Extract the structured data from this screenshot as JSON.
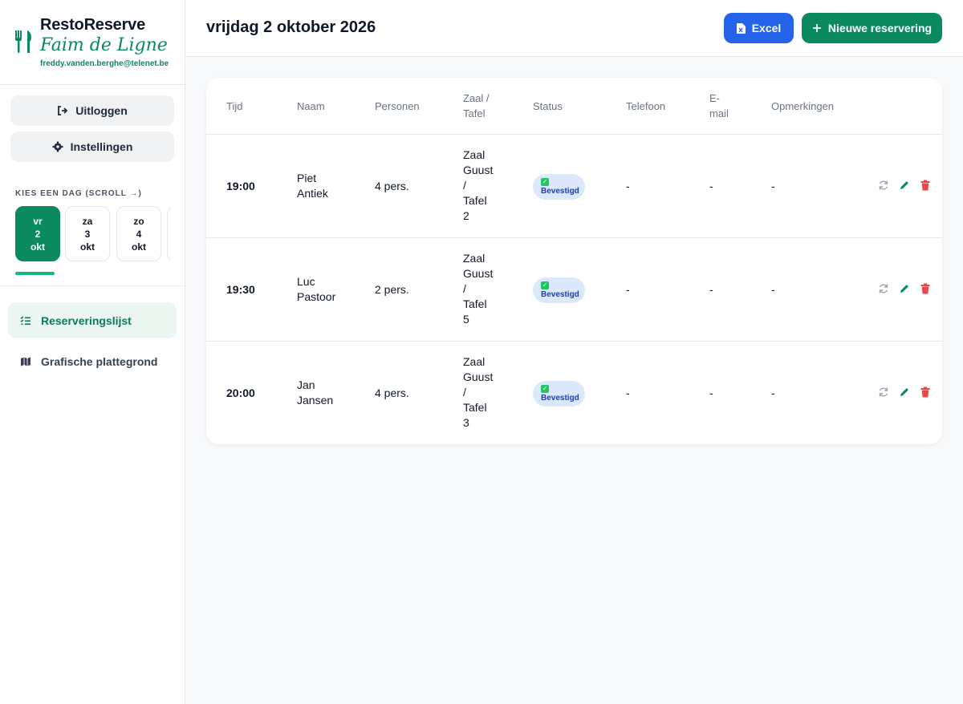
{
  "brand": {
    "title": "RestoReserve",
    "subtitle": "Faim de Ligne",
    "email": "freddy.vanden.berghe@telenet.be"
  },
  "sidebar": {
    "logout_label": "Uitloggen",
    "settings_label": "Instellingen",
    "day_picker_label": "KIES EEN DAG (SCROLL →)",
    "days": [
      {
        "dow": "vr",
        "day": "2",
        "month": "okt"
      },
      {
        "dow": "za",
        "day": "3",
        "month": "okt"
      },
      {
        "dow": "zo",
        "day": "4",
        "month": "okt"
      }
    ],
    "nav": [
      {
        "label": "Reserveringslijst"
      },
      {
        "label": "Grafische plattegrond"
      }
    ]
  },
  "header": {
    "title": "vrijdag 2 oktober 2026",
    "excel_label": "Excel",
    "new_label": "Nieuwe reservering"
  },
  "table": {
    "columns": [
      "Tijd",
      "Naam",
      "Personen",
      "Zaal /",
      "Tafel",
      "Status",
      "Telefoon",
      "E-",
      "mail",
      "Opmerkingen"
    ],
    "rows": [
      {
        "time": "19:00",
        "name1": "Piet",
        "name2": "Antiek",
        "persons": "4 pers.",
        "z1": "Zaal",
        "z2": "Guust",
        "z3": "/",
        "z4": "Tafel",
        "z5": "2",
        "status": "Bevestigd",
        "phone": "-",
        "email": "-",
        "notes": "-"
      },
      {
        "time": "19:30",
        "name1": "Luc",
        "name2": "Pastoor",
        "persons": "2 pers.",
        "z1": "Zaal",
        "z2": "Guust",
        "z3": "/",
        "z4": "Tafel",
        "z5": "5",
        "status": "Bevestigd",
        "phone": "-",
        "email": "-",
        "notes": "-"
      },
      {
        "time": "20:00",
        "name1": "Jan",
        "name2": "Jansen",
        "persons": "4 pers.",
        "z1": "Zaal",
        "z2": "Guust",
        "z3": "/",
        "z4": "Tafel",
        "z5": "3",
        "status": "Bevestigd",
        "phone": "-",
        "email": "-",
        "notes": "-"
      }
    ]
  },
  "colors": {
    "primary_green": "#0b8a5f",
    "excel_blue": "#2563eb",
    "delete_red": "#ef4444"
  },
  "icons": [
    "fork-knife-icon",
    "logout-icon",
    "gear-icon",
    "list-icon",
    "map-icon",
    "file-excel-icon",
    "plus-icon",
    "refresh-icon",
    "pencil-icon",
    "trash-icon",
    "check-icon"
  ]
}
